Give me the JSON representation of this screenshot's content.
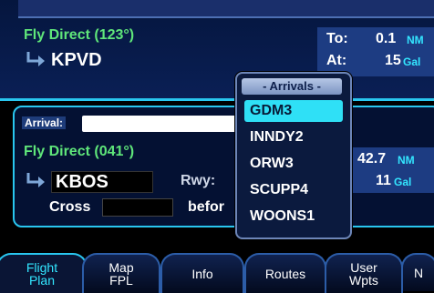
{
  "top": {
    "route_label": "Fly Direct (123°)",
    "waypoint": "KPVD",
    "to_label": "To:",
    "to_value": "0.1",
    "to_unit": "NM",
    "at_label": "At:",
    "at_value": "15",
    "at_unit": "Gal"
  },
  "middle": {
    "arrival_label": "Arrival:",
    "route_label": "Fly Direct (041°)",
    "waypoint": "KBOS",
    "rwy_label": "Rwy:",
    "cross_label": "Cross",
    "before_label": "befor",
    "dist_value": "42.7",
    "dist_unit": "NM",
    "fuel_value": "11",
    "fuel_unit": "Gal"
  },
  "popup": {
    "title": "- Arrivals -",
    "items": [
      "GDM3",
      "INNDY2",
      "ORW3",
      "SCUPP4",
      "WOONS1"
    ],
    "selected_index": 0
  },
  "softkeys": [
    {
      "label": "Flight\nPlan",
      "active": true
    },
    {
      "label": "Map\nFPL",
      "active": false
    },
    {
      "label": "Info",
      "active": false
    },
    {
      "label": "Routes",
      "active": false
    },
    {
      "label": "User\nWpts",
      "active": false
    },
    {
      "label": "N",
      "active": false
    }
  ],
  "colors": {
    "accent": "#29c6ef",
    "text_green": "#5fe67a",
    "selection": "#2fe0f6"
  }
}
